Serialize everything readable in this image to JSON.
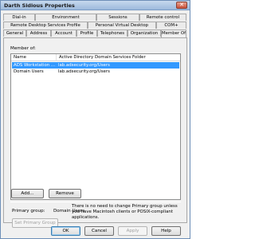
{
  "window": {
    "title": "Darth Sidious Properties",
    "close_label": "✕"
  },
  "tabs": {
    "row1": [
      "Dial-in",
      "Environment",
      "Sessions",
      "Remote control"
    ],
    "row2": [
      "Remote Desktop Services Profile",
      "Personal Virtual Desktop",
      "COM+"
    ],
    "row3": [
      "General",
      "Address",
      "Account",
      "Profile",
      "Telephones",
      "Organization",
      "Member Of"
    ],
    "active": "Member Of"
  },
  "member_of": {
    "label": "Member of:",
    "columns": [
      "Name",
      "Active Directory Domain Services Folder"
    ],
    "rows": [
      {
        "name": "ADS Workstation ...",
        "folder": "lab.adsecurity.org/Users",
        "selected": true
      },
      {
        "name": "Domain Users",
        "folder": "lab.adsecurity.org/Users",
        "selected": false
      }
    ]
  },
  "buttons": {
    "add": "Add...",
    "remove": "Remove",
    "set_primary": "Set Primary Group"
  },
  "primary_group": {
    "label": "Primary group:",
    "value": "Domain Users",
    "note": "There is no need to change Primary group unless you have Macintosh clients or POSIX-compliant applications."
  },
  "footer": {
    "ok": "OK",
    "cancel": "Cancel",
    "apply": "Apply",
    "help": "Help"
  },
  "colors": {
    "selection": "#3399ff",
    "title_gradient_top": "#c7d9ee",
    "title_gradient_bottom": "#9cb9dc"
  }
}
